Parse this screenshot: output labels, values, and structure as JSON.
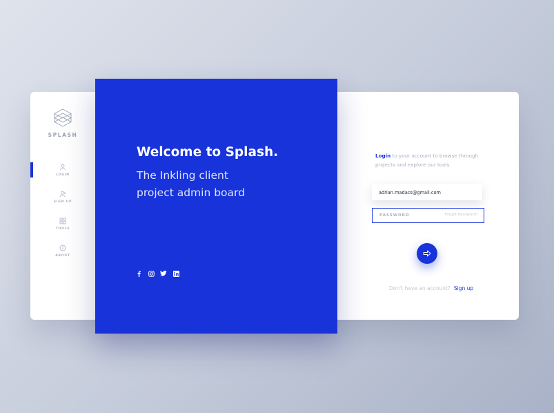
{
  "sidebar": {
    "logo_text": "SPLASH",
    "items": [
      {
        "label": "LOGIN",
        "icon": "user-icon",
        "active": true
      },
      {
        "label": "SIGN UP",
        "icon": "user-add-icon",
        "active": false
      },
      {
        "label": "TOOLS",
        "icon": "grid-icon",
        "active": false
      },
      {
        "label": "ABOUT",
        "icon": "info-icon",
        "active": false
      }
    ]
  },
  "hero": {
    "title": "Welcome to Splash.",
    "subtitle_line1": "The Inkling client",
    "subtitle_line2": "project admin board",
    "socials": [
      "facebook-icon",
      "instagram-icon",
      "twitter-icon",
      "linkedin-icon"
    ]
  },
  "login": {
    "intro_link": "Login",
    "intro_rest": " to your account to browse through projects and explore our tools.",
    "email_value": "adrian.madacs@gmail.com",
    "password_placeholder": "PASSWORD",
    "forgot_label": "Forgot Password?",
    "signup_prompt": "Don't have an account?",
    "signup_link": "Sign up"
  },
  "colors": {
    "accent": "#1733d9",
    "card": "#ffffff",
    "muted_text": "#a9afbf"
  }
}
